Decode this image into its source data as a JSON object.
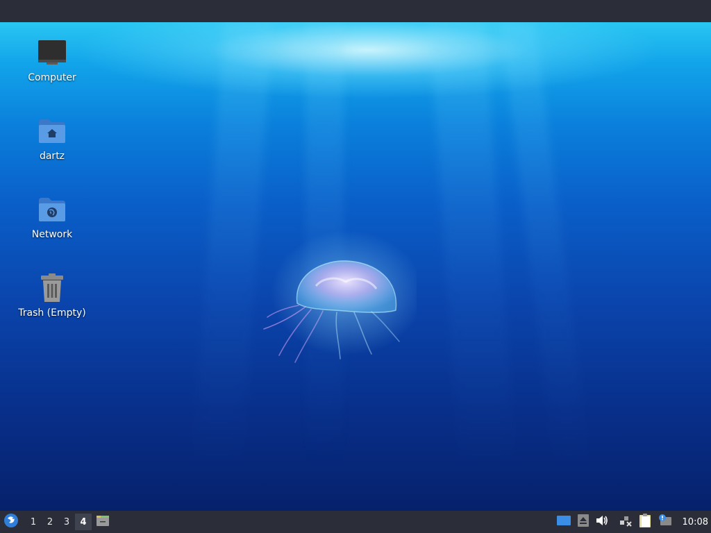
{
  "desktop": {
    "icons": [
      {
        "label": "Computer"
      },
      {
        "label": "dartz"
      },
      {
        "label": "Network"
      },
      {
        "label": "Trash (Empty)"
      }
    ]
  },
  "panel": {
    "workspaces": [
      "1",
      "2",
      "3",
      "4"
    ],
    "active_workspace": "4",
    "clock": "10:08"
  },
  "icons": {
    "menu": "xfce-menu-icon",
    "show_desktop": "show-desktop-icon",
    "tray": [
      "workspace-display-icon",
      "eject-icon",
      "volume-icon",
      "network-icon",
      "clipboard-icon",
      "notification-icon"
    ]
  },
  "colors": {
    "panel_bg": "#2b2d38",
    "folder_blue": "#4a8fde",
    "accent": "#3a8ee6"
  }
}
